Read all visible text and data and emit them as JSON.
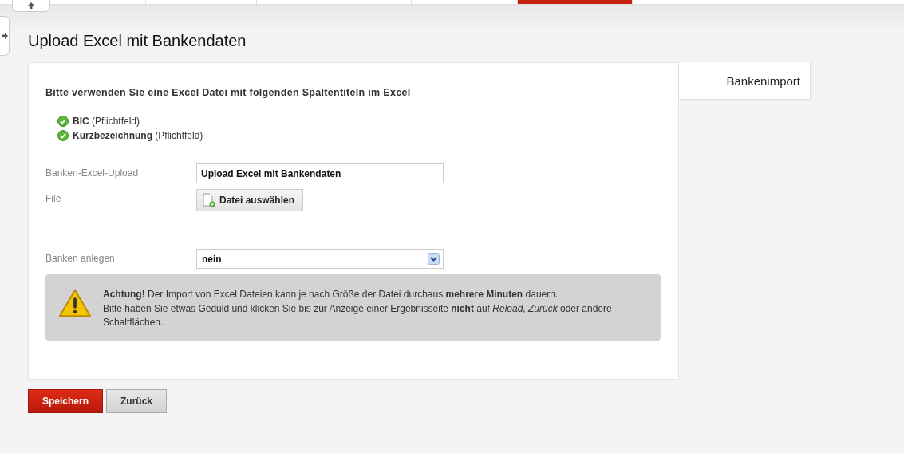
{
  "nav_tabs": [
    {
      "selected": false
    },
    {
      "selected": false
    },
    {
      "selected": false
    },
    {
      "selected": true
    },
    {
      "selected": false
    }
  ],
  "title": "Upload Excel mit Bankendaten",
  "side_tab": "Bankenimport",
  "intro": "Bitte verwenden Sie eine Excel Datei mit folgenden Spaltentiteln im Excel",
  "columns": [
    {
      "name": "BIC",
      "note": "(Pflichtfeld)"
    },
    {
      "name": "Kurzbezeichnung",
      "note": "(Pflichtfeld)"
    }
  ],
  "fields": [
    {
      "kind": "text",
      "label": "Banken-Excel-Upload",
      "value": "Upload Excel mit Bankendaten"
    },
    {
      "kind": "file",
      "label": "File",
      "button": "Datei auswählen"
    },
    {
      "kind": "select",
      "label": "Banken anlegen",
      "value": "nein"
    }
  ],
  "warning": {
    "lines": [
      "**Achtung!** Der Import von Excel Dateien kann je nach Größe der Datei durchaus **mehrere Minuten** dauern.",
      "Bitte haben Sie etwas Geduld und klicken Sie bis zur Anzeige einer Ergebnisseite **nicht** auf *Reload*, *Zurück* oder andere Schaltflächen."
    ]
  },
  "buttons": [
    {
      "label": "Speichern",
      "primary": true
    },
    {
      "label": "Zurück",
      "primary": false
    }
  ]
}
